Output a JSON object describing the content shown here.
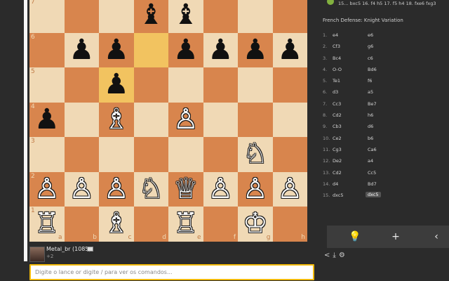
{
  "board": {
    "ranks_shown": [
      "7",
      "6",
      "5",
      "4",
      "3",
      "2",
      "1"
    ],
    "files": [
      "a",
      "b",
      "c",
      "d",
      "e",
      "f",
      "g",
      "h"
    ],
    "highlight_squares": [
      "d6",
      "c5"
    ],
    "pieces": [
      {
        "sq": "d7",
        "glyph": "♝",
        "color": "b",
        "name": "black-bishop-d7"
      },
      {
        "sq": "e7",
        "glyph": "♝",
        "color": "b",
        "name": "black-bishop-e7"
      },
      {
        "sq": "b6",
        "glyph": "♟",
        "color": "b",
        "name": "black-pawn-b6"
      },
      {
        "sq": "c6",
        "glyph": "♟",
        "color": "b",
        "name": "black-pawn-c6"
      },
      {
        "sq": "e6",
        "glyph": "♟",
        "color": "b",
        "name": "black-pawn-e6"
      },
      {
        "sq": "f6",
        "glyph": "♟",
        "color": "b",
        "name": "black-pawn-f6"
      },
      {
        "sq": "g6",
        "glyph": "♟",
        "color": "b",
        "name": "black-pawn-g6"
      },
      {
        "sq": "h6",
        "glyph": "♟",
        "color": "b",
        "name": "black-pawn-h6"
      },
      {
        "sq": "c5",
        "glyph": "♟",
        "color": "b",
        "name": "black-pawn-c5"
      },
      {
        "sq": "a4",
        "glyph": "♟",
        "color": "b",
        "name": "black-pawn-a4"
      },
      {
        "sq": "c4",
        "glyph": "♗",
        "color": "w",
        "name": "white-bishop-c4"
      },
      {
        "sq": "e4",
        "glyph": "♙",
        "color": "w",
        "name": "white-pawn-e4"
      },
      {
        "sq": "g3",
        "glyph": "♘",
        "color": "w",
        "name": "white-knight-g3"
      },
      {
        "sq": "a2",
        "glyph": "♙",
        "color": "w",
        "name": "white-pawn-a2"
      },
      {
        "sq": "b2",
        "glyph": "♙",
        "color": "w",
        "name": "white-pawn-b2"
      },
      {
        "sq": "c2",
        "glyph": "♙",
        "color": "w",
        "name": "white-pawn-c2"
      },
      {
        "sq": "d2",
        "glyph": "♘",
        "color": "w",
        "name": "white-knight-d2"
      },
      {
        "sq": "e2",
        "glyph": "♕",
        "color": "w",
        "name": "white-queen-e2"
      },
      {
        "sq": "f2",
        "glyph": "♙",
        "color": "w",
        "name": "white-pawn-f2"
      },
      {
        "sq": "g2",
        "glyph": "♙",
        "color": "w",
        "name": "white-pawn-g2"
      },
      {
        "sq": "h2",
        "glyph": "♙",
        "color": "w",
        "name": "white-pawn-h2"
      },
      {
        "sq": "a1",
        "glyph": "♖",
        "color": "w",
        "name": "white-rook-a1"
      },
      {
        "sq": "c1",
        "glyph": "♗",
        "color": "w",
        "name": "white-bishop-c1"
      },
      {
        "sq": "e1",
        "glyph": "♖",
        "color": "w",
        "name": "white-rook-e1"
      },
      {
        "sq": "g1",
        "glyph": "♔",
        "color": "w",
        "name": "white-king-g1"
      }
    ]
  },
  "player": {
    "name": "Metal_br",
    "rating": "(1085)",
    "sub": "+2"
  },
  "command_input": {
    "placeholder": "Digite o lance or digite / para ver os comandos..."
  },
  "panel": {
    "top_moves": "15... bxc5 16. f4 h5 17. f5 h4 18. fxe6 fxg3",
    "opening": "French Defense: Knight Variation",
    "moves": [
      {
        "n": "1.",
        "w": "e4",
        "b": "e6"
      },
      {
        "n": "2.",
        "w": "Cf3",
        "b": "g6"
      },
      {
        "n": "3.",
        "w": "Bc4",
        "b": "c6"
      },
      {
        "n": "4.",
        "w": "O-O",
        "b": "Bd6"
      },
      {
        "n": "5.",
        "w": "Te1",
        "b": "f6"
      },
      {
        "n": "6.",
        "w": "d3",
        "b": "a5"
      },
      {
        "n": "7.",
        "w": "Cc3",
        "b": "Be7"
      },
      {
        "n": "8.",
        "w": "Cd2",
        "b": "h6"
      },
      {
        "n": "9.",
        "w": "Cb3",
        "b": "d6"
      },
      {
        "n": "10.",
        "w": "Ce2",
        "b": "b6"
      },
      {
        "n": "11.",
        "w": "Cg3",
        "b": "Ca6"
      },
      {
        "n": "12.",
        "w": "De2",
        "b": "a4"
      },
      {
        "n": "13.",
        "w": "Cd2",
        "b": "Cc5"
      },
      {
        "n": "14.",
        "w": "d4",
        "b": "Bd7"
      },
      {
        "n": "15.",
        "w": "dxc5",
        "b": "dxc5"
      }
    ],
    "current_move_index": 14,
    "controls": [
      {
        "name": "hint-lightbulb-icon",
        "glyph": "💡"
      },
      {
        "name": "add-icon",
        "glyph": "+"
      },
      {
        "name": "previous-chevron-icon",
        "glyph": "‹"
      }
    ],
    "bottom_icons": [
      {
        "name": "share-icon",
        "glyph": "<"
      },
      {
        "name": "download-icon",
        "glyph": "⤓"
      },
      {
        "name": "settings-gear-icon",
        "glyph": "⚙"
      }
    ]
  }
}
